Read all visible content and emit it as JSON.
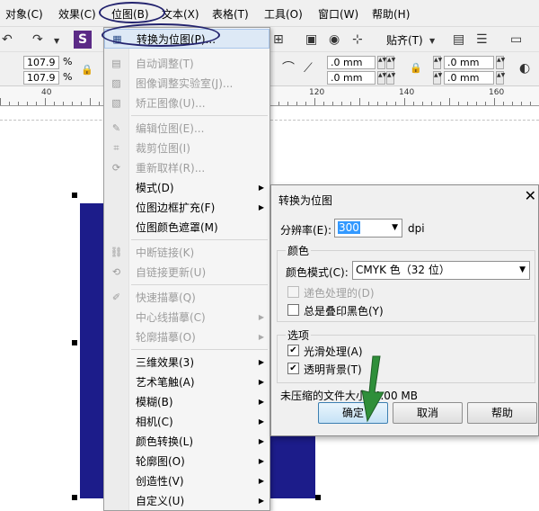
{
  "menubar": {
    "items": [
      {
        "label": "对象(C)"
      },
      {
        "label": "效果(C)"
      },
      {
        "label": "位图(B)"
      },
      {
        "label": "文本(X)"
      },
      {
        "label": "表格(T)"
      },
      {
        "label": "工具(O)"
      },
      {
        "label": "窗口(W)"
      },
      {
        "label": "帮助(H)"
      }
    ]
  },
  "toolbar": {
    "align_label": "贴齐(T)",
    "w_value": "107.9",
    "h_value": "107.9",
    "pct1": "%",
    "pct2": "%",
    "x_value": ".0 mm",
    "y_value": ".0 mm",
    "x2_value": ".0 mm",
    "y2_value": ".0 mm"
  },
  "ruler": {
    "labels": [
      "40",
      "120",
      "140",
      "160"
    ]
  },
  "bitmap_menu": {
    "items": [
      {
        "label": "转换为位图(P)...",
        "enabled": true,
        "icon": "convert-icon"
      },
      {
        "label": "自动调整(T)",
        "enabled": false,
        "icon": "auto-adjust-icon"
      },
      {
        "label": "图像调整实验室(J)...",
        "enabled": false,
        "icon": "image-lab-icon"
      },
      {
        "label": "矫正图像(U)...",
        "enabled": false,
        "icon": "straighten-icon"
      },
      {
        "label": "编辑位图(E)...",
        "enabled": false,
        "icon": "edit-bitmap-icon"
      },
      {
        "label": "裁剪位图(I)",
        "enabled": false,
        "icon": "crop-icon"
      },
      {
        "label": "重新取样(R)...",
        "enabled": false,
        "icon": "resample-icon"
      },
      {
        "label": "模式(D)",
        "enabled": true,
        "submenu": true
      },
      {
        "label": "位图边框扩充(F)",
        "enabled": true,
        "submenu": true
      },
      {
        "label": "位图颜色遮罩(M)",
        "enabled": true
      },
      {
        "label": "中断链接(K)",
        "enabled": false,
        "icon": "break-link-icon"
      },
      {
        "label": "自链接更新(U)",
        "enabled": false,
        "icon": "update-link-icon"
      },
      {
        "label": "快速描摹(Q)",
        "enabled": false,
        "icon": "quick-trace-icon"
      },
      {
        "label": "中心线描摹(C)",
        "enabled": false,
        "submenu": true
      },
      {
        "label": "轮廓描摹(O)",
        "enabled": false,
        "submenu": true
      },
      {
        "label": "三维效果(3)",
        "enabled": true,
        "submenu": true
      },
      {
        "label": "艺术笔触(A)",
        "enabled": true,
        "submenu": true
      },
      {
        "label": "模糊(B)",
        "enabled": true,
        "submenu": true
      },
      {
        "label": "相机(C)",
        "enabled": true,
        "submenu": true
      },
      {
        "label": "颜色转换(L)",
        "enabled": true,
        "submenu": true
      },
      {
        "label": "轮廓图(O)",
        "enabled": true,
        "submenu": true
      },
      {
        "label": "创造性(V)",
        "enabled": true,
        "submenu": true
      },
      {
        "label": "自定义(U)",
        "enabled": true,
        "submenu": true
      }
    ]
  },
  "dialog": {
    "title": "转换为位图",
    "close": "✕",
    "resolution_label": "分辨率(E):",
    "resolution_value": "300",
    "resolution_unit": "dpi",
    "color_group": "颜色",
    "color_mode_label": "颜色模式(C):",
    "color_mode_value": "CMYK 色（32 位）",
    "dither_label": "递色处理的(D)",
    "overprint_label": "总是叠印黑色(Y)",
    "options_group": "选项",
    "antialias_label": "光滑处理(A)",
    "transparent_label": "透明背景(T)",
    "filesize_text": "未压缩的文件大小: 4.00 MB",
    "ok": "确定",
    "cancel": "取消",
    "help": "帮助",
    "dither_checked": false,
    "overprint_checked": false,
    "antialias_checked": true,
    "transparent_checked": true
  },
  "colors": {
    "rect_fill": "#1c1c8a",
    "highlight_ring": "#23236e",
    "arrow": "#2f8f3a"
  }
}
